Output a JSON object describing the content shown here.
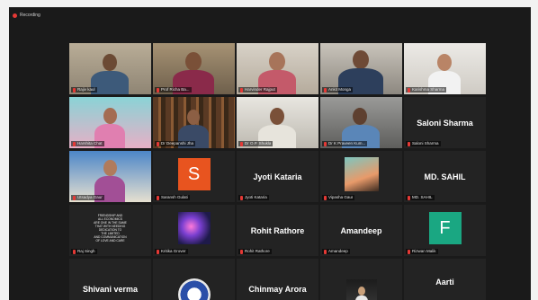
{
  "recording": {
    "label": "Recording",
    "color": "#e53935"
  },
  "colors": {
    "active_speaker": "#d9e022",
    "avatar_s": "#e8541f",
    "avatar_f": "#1aa782"
  },
  "tiles": [
    {
      "name": "Rajiv kaul"
    },
    {
      "name": "Prof Richa Ba..."
    },
    {
      "name": "Harvinder Rajput"
    },
    {
      "name": "Ankit Monga"
    },
    {
      "name": "Karishma Sharma"
    },
    {
      "name": "Harshita Chat"
    },
    {
      "name": "Dr Deepanshi Jha"
    },
    {
      "name": "Dr O.P. Shukla"
    },
    {
      "name": "Dr K Praveen Kum..."
    },
    {
      "name": "Saloni Sharma",
      "big": "Saloni Sharma"
    },
    {
      "name": "Utsadya Gaur"
    },
    {
      "name": "Saransh Gulati",
      "avatar": "S"
    },
    {
      "name": "Jyoti Kataria",
      "big": "Jyoti Kataria"
    },
    {
      "name": "Vipasha Gaur"
    },
    {
      "name": "MD. SAHIL",
      "big": "MD. SAHIL"
    },
    {
      "name": "Raj Singh"
    },
    {
      "name": "Kritika Grover"
    },
    {
      "name": "Rohit Rathore",
      "big": "Rohit Rathore"
    },
    {
      "name": "Amandeep",
      "big": "Amandeep"
    },
    {
      "name": "Rizwan Malik",
      "avatar": "F"
    },
    {
      "big": "Shivani verma"
    },
    {
      "name": ""
    },
    {
      "big": "Chinmay Arora"
    },
    {
      "name": ""
    },
    {
      "big": "Aarti"
    }
  ],
  "poster_lines": [
    "FRIENDSHIP AND",
    "ALL ECONOMICS",
    "ARE ONE IN THE SAME",
    "THAT WITH NEEDING",
    "DEDICATION TO",
    "THE LIMITED",
    "AND COMMUNICATION",
    "OF LOVE AND CARE"
  ]
}
